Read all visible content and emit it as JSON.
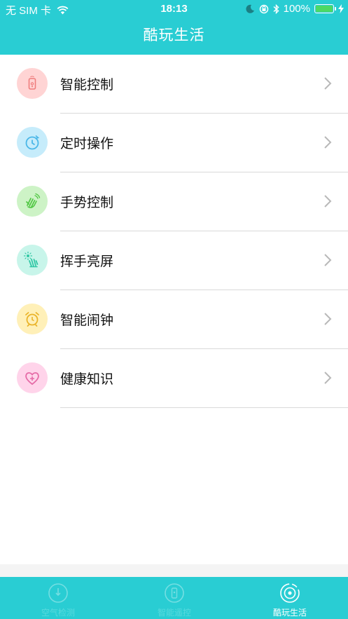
{
  "status_bar": {
    "carrier": "无 SIM 卡",
    "time": "18:13",
    "battery_percent": "100%"
  },
  "header": {
    "title": "酷玩生活"
  },
  "menu": {
    "items": [
      {
        "label": "智能控制",
        "icon": "remote-control-icon",
        "icon_bg": "#ffd4d4",
        "icon_color": "#ef7d7d"
      },
      {
        "label": "定时操作",
        "icon": "clock-icon",
        "icon_bg": "#c6ecfb",
        "icon_color": "#4ab7e8"
      },
      {
        "label": "手势控制",
        "icon": "hand-wave-icon",
        "icon_bg": "#cdf3c6",
        "icon_color": "#53c846"
      },
      {
        "label": "挥手亮屏",
        "icon": "hand-light-icon",
        "icon_bg": "#c8f5ea",
        "icon_color": "#31c8a5"
      },
      {
        "label": "智能闹钟",
        "icon": "alarm-clock-icon",
        "icon_bg": "#fff0b8",
        "icon_color": "#eab42a"
      },
      {
        "label": "健康知识",
        "icon": "heart-plus-icon",
        "icon_bg": "#ffd4ea",
        "icon_color": "#e56aa6"
      }
    ]
  },
  "tab_bar": {
    "tabs": [
      {
        "label": "空气检测",
        "active": false
      },
      {
        "label": "智能遥控",
        "active": false
      },
      {
        "label": "酷玩生活",
        "active": true
      }
    ]
  },
  "colors": {
    "accent": "#29cdd3",
    "divider": "#d9d9d9",
    "chevron": "#b8b8b8"
  }
}
